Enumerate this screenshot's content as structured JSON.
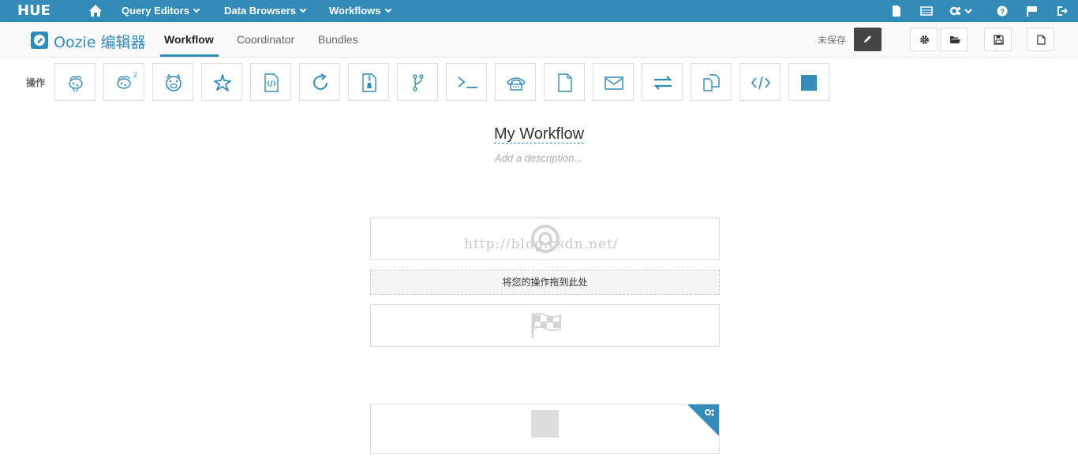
{
  "topnav": {
    "logo": "HUE",
    "menus": [
      {
        "label": "Query Editors"
      },
      {
        "label": "Data Browsers"
      },
      {
        "label": "Workflows"
      }
    ]
  },
  "subhead": {
    "title": "Oozie 编辑器",
    "tabs": [
      "Workflow",
      "Coordinator",
      "Bundles"
    ],
    "active_tab": "Workflow",
    "status": "未保存"
  },
  "actions": {
    "label": "操作",
    "items": [
      "hive-icon",
      "hive2-icon",
      "pig-icon",
      "spark-icon",
      "java-icon",
      "sqoop-icon",
      "mapreduce-icon",
      "subworkflow-icon",
      "shell-icon",
      "ssh-icon",
      "hdfs-fs-icon",
      "email-icon",
      "streaming-icon",
      "distcp-icon",
      "generic-icon",
      "kill-icon"
    ]
  },
  "workflow": {
    "name": "My Workflow",
    "description_placeholder": "Add a description...",
    "drop_hint": "将您的操作拖到此处",
    "watermark": "http://blog.csdn.net/"
  },
  "colors": {
    "accent": "#338bb8",
    "nav_bg": "#338bb8",
    "edit_btn": "#444444"
  }
}
